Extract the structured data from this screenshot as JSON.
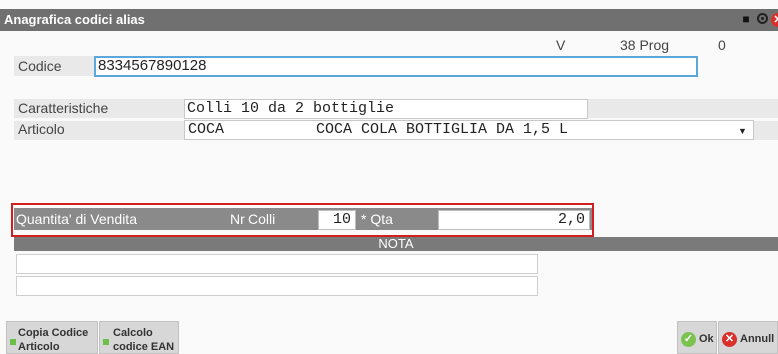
{
  "window": {
    "title": "Anagrafica codici alias"
  },
  "header": {
    "v_label": "V",
    "prog_label": "38 Prog",
    "prog_value": "0"
  },
  "codice": {
    "label": "Codice",
    "value": "8334567890128"
  },
  "caratteristiche": {
    "label": "Caratteristiche",
    "value": "Colli 10 da 2 bottiglie"
  },
  "articolo": {
    "label": "Articolo",
    "code": "COCA",
    "description": "COCA COLA BOTTIGLIA DA 1,5 L"
  },
  "quantita": {
    "label": "Quantita' di Vendita",
    "nr_label": "Nr",
    "colli_label": "Colli",
    "colli_value": "10",
    "qta_label": "* Qta",
    "qta_value": "2,0"
  },
  "nota": {
    "label": "NOTA"
  },
  "buttons": {
    "copia_line1": "Copia Codice",
    "copia_line2": "Articolo",
    "calcolo_line1": "Calcolo",
    "calcolo_line2": "codice EAN",
    "ok": "Ok",
    "annulla": "Annull"
  },
  "colors": {
    "titlebar": "#707070",
    "highlight_frame": "#d11f1f",
    "focus_border": "#5aa7dc",
    "ok_green": "#7cc24f",
    "cancel_red": "#d9302b"
  },
  "icons": [
    "pin-icon",
    "radio-icon",
    "close-icon",
    "dropdown-icon",
    "check-icon",
    "cancel-icon"
  ]
}
